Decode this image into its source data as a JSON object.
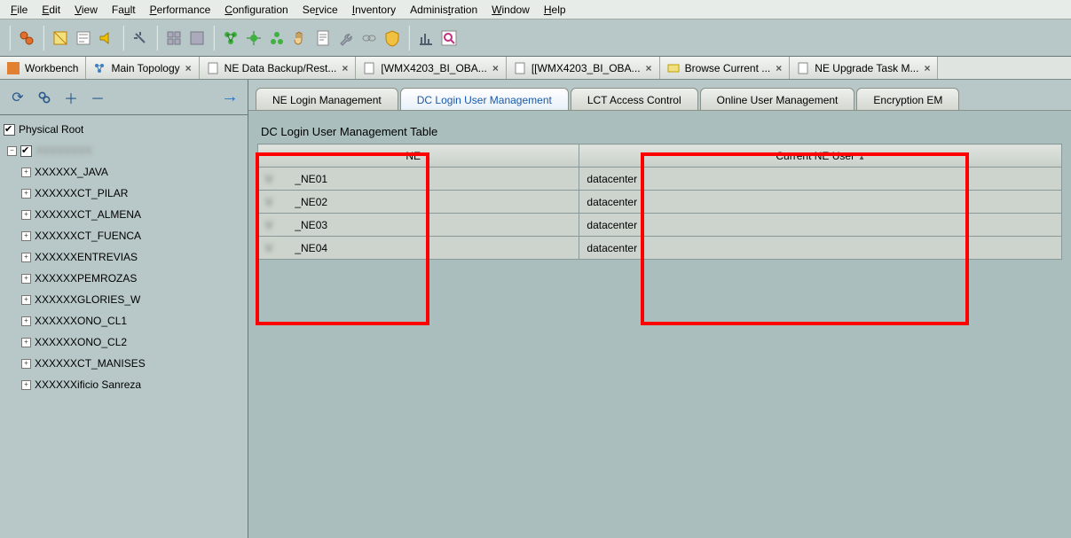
{
  "menu": {
    "items": [
      "File",
      "Edit",
      "View",
      "Fault",
      "Performance",
      "Configuration",
      "Service",
      "Inventory",
      "Administration",
      "Window",
      "Help"
    ],
    "underlines": [
      "F",
      "E",
      "V",
      "u",
      "P",
      "C",
      "r",
      "I",
      "t",
      "W",
      "H"
    ]
  },
  "wintabs": [
    {
      "label": "Workbench",
      "closable": false,
      "icon": "workbench"
    },
    {
      "label": "Main Topology",
      "closable": true,
      "icon": "topology"
    },
    {
      "label": "NE Data Backup/Rest...",
      "closable": true,
      "icon": "doc"
    },
    {
      "label": "[WMX4203_BI_OBA...",
      "closable": true,
      "icon": "doc"
    },
    {
      "label": "[[WMX4203_BI_OBA...",
      "closable": true,
      "icon": "doc"
    },
    {
      "label": "Browse Current ...",
      "closable": true,
      "icon": "browse"
    },
    {
      "label": "NE Upgrade Task M...",
      "closable": true,
      "icon": "doc"
    }
  ],
  "tree": {
    "root": {
      "label": "Physical Root",
      "checked": true
    },
    "group": {
      "checked": true
    },
    "items": [
      "_JAVA",
      "CT_PILAR",
      "CT_ALMENA",
      "CT_FUENCA",
      "ENTREVIAS",
      "PEMROZAS",
      "GLORIES_W",
      "ONO_CL1",
      "ONO_CL2",
      "CT_MANISES",
      "ificio Sanreza"
    ]
  },
  "subtabs": [
    {
      "label": "NE Login Management",
      "active": false
    },
    {
      "label": "DC Login User Management",
      "active": true
    },
    {
      "label": "LCT Access Control",
      "active": false
    },
    {
      "label": "Online User Management",
      "active": false
    },
    {
      "label": "Encryption EM",
      "active": false
    }
  ],
  "table": {
    "title": "DC Login User Management Table",
    "columns": [
      "NE",
      "Current NE User"
    ],
    "rows": [
      {
        "ne": "_NE01",
        "user": "datacenter"
      },
      {
        "ne": "_NE02",
        "user": "datacenter"
      },
      {
        "ne": "_NE03",
        "user": "datacenter"
      },
      {
        "ne": "_NE04",
        "user": "datacenter"
      }
    ]
  }
}
